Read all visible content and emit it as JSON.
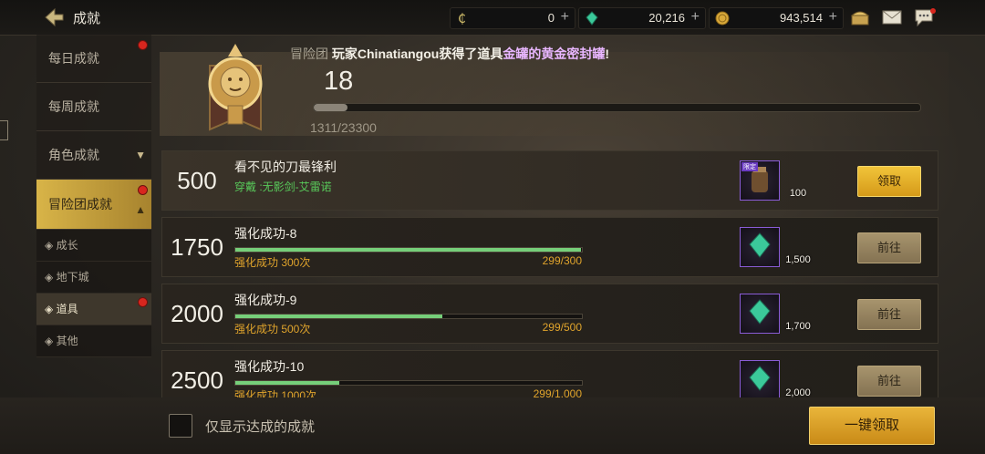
{
  "header": {
    "title": "成就",
    "currencies": [
      {
        "icon": "coin-c-icon",
        "value": "0"
      },
      {
        "icon": "green-crystal-icon",
        "value": "20,216"
      },
      {
        "icon": "gold-coin-icon",
        "value": "943,514"
      }
    ]
  },
  "sidebar": {
    "items": [
      {
        "label": "每日成就",
        "badge": true
      },
      {
        "label": "每周成就",
        "badge": false
      },
      {
        "label": "角色成就",
        "badge": false
      },
      {
        "label": "冒险团成就",
        "badge": true
      }
    ],
    "subitems": [
      {
        "label": "◈ 成长",
        "badge": false
      },
      {
        "label": "◈ 地下城",
        "badge": false
      },
      {
        "label": "◈ 道具",
        "badge": true
      },
      {
        "label": "◈ 其他",
        "badge": false
      }
    ]
  },
  "summary": {
    "ticker_prefix": "冒险团",
    "ticker_text": "玩家Chinatiangou获得了道具",
    "ticker_item": "金罐的黄金密封罐",
    "ticker_suffix": "!",
    "level": "18",
    "progress_text": "1311/23300",
    "progress_fraction": 0.056
  },
  "achievements": [
    {
      "points": "500",
      "name": "看不见的刀最锋利",
      "sub": "穿戴 :无影剑-艾雷诺",
      "progress": null,
      "count": "",
      "reward_count": "100",
      "reward_tag": "限定",
      "button": "领取",
      "claimable": true
    },
    {
      "points": "1750",
      "name": "强化成功-8",
      "sub": "强化成功 300次",
      "progress": 0.997,
      "count": "299/300",
      "reward_count": "1,500",
      "reward_tag": "",
      "button": "前往",
      "claimable": false
    },
    {
      "points": "2000",
      "name": "强化成功-9",
      "sub": "强化成功 500次",
      "progress": 0.598,
      "count": "299/500",
      "reward_count": "1,700",
      "reward_tag": "",
      "button": "前往",
      "claimable": false
    },
    {
      "points": "2500",
      "name": "强化成功-10",
      "sub": "强化成功 1000次",
      "progress": 0.299,
      "count": "299/1,000",
      "reward_count": "2,000",
      "reward_tag": "",
      "button": "前往",
      "claimable": false
    }
  ],
  "footer": {
    "checkbox_label": "仅显示达成的成就",
    "claim_all": "一键领取"
  },
  "colors": {
    "accent_gold": "#d59a19",
    "progress_green": "#76cf7a",
    "badge_red": "#d8261e"
  }
}
